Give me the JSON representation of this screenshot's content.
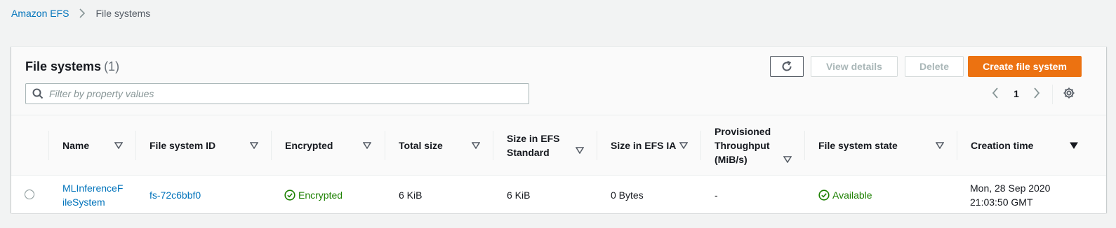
{
  "breadcrumb": {
    "root": "Amazon EFS",
    "current": "File systems"
  },
  "panel": {
    "title": "File systems",
    "count": "(1)"
  },
  "buttons": {
    "refresh_icon": "refresh-icon",
    "view_details": "View details",
    "delete": "Delete",
    "create": "Create file system"
  },
  "filter": {
    "placeholder": "Filter by property values",
    "value": ""
  },
  "pagination": {
    "current_page": "1"
  },
  "columns": [
    "Name",
    "File system ID",
    "Encrypted",
    "Total size",
    "Size in EFS Standard",
    "Size in EFS IA",
    "Provisioned Throughput (MiB/s)",
    "File system state",
    "Creation time"
  ],
  "rows": [
    {
      "name_line1": "MLInferenceF",
      "name_line2": "ileSystem",
      "fs_id": "fs-72c6bbf0",
      "encrypted": "Encrypted",
      "total_size": "6 KiB",
      "size_standard": "6 KiB",
      "size_ia": "0 Bytes",
      "throughput": "-",
      "state": "Available",
      "created_line1": "Mon, 28 Sep 2020",
      "created_line2": "21:03:50 GMT"
    }
  ],
  "colors": {
    "link": "#0073bb",
    "primary": "#ec7211",
    "success": "#1d8102",
    "disabled": "#aab7b8"
  }
}
